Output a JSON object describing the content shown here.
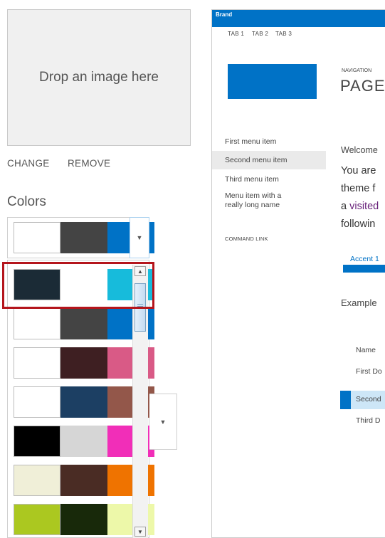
{
  "dropzone": {
    "label": "Drop an image here"
  },
  "actions": {
    "change": "CHANGE",
    "remove": "REMOVE"
  },
  "colors_heading": "Colors",
  "selected_scheme": [
    "#ffffff",
    "#444444",
    "#0072c6"
  ],
  "schemes": [
    [
      "#1b2b36",
      "#ffffff",
      "#17bbdb"
    ],
    [
      "#ffffff",
      "#444444",
      "#0072c6"
    ],
    [
      "#ffffff",
      "#3e1f22",
      "#d95a86"
    ],
    [
      "#ffffff",
      "#1c3f63",
      "#93574a"
    ],
    [
      "#000000",
      "#d6d6d6",
      "#f12eb8"
    ],
    [
      "#f0efd8",
      "#4a2c24",
      "#ef7300"
    ],
    [
      "#abc820",
      "#18290a",
      "#edf8a9"
    ]
  ],
  "highlighted_index": 0,
  "preview": {
    "brand": "Brand",
    "tabs": [
      "TAB 1",
      "TAB 2",
      "TAB 3"
    ],
    "nav_label": "NAVIGATION",
    "page_title": "PAGE",
    "menu": {
      "first": "First menu item",
      "second": "Second menu item",
      "third": "Third menu item",
      "long_line1": "Menu item with a",
      "long_line2": "really long name",
      "command": "COMMAND LINK"
    },
    "welcome": "Welcome",
    "body_line1": "You are",
    "body_line2": "theme f",
    "body_line3_prefix": "a ",
    "body_line3_link": "visited",
    "body_line4": "followin",
    "accent_label": "Accent 1",
    "example_heading": "Example",
    "table_header": "Name",
    "rows": [
      "First Do",
      "Second",
      "Third D"
    ],
    "accent_color": "#0072c6"
  },
  "icons": {
    "dropdown": "chevron-down-icon",
    "scroll_up": "scroll-up-icon",
    "scroll_down": "scroll-down-icon"
  }
}
